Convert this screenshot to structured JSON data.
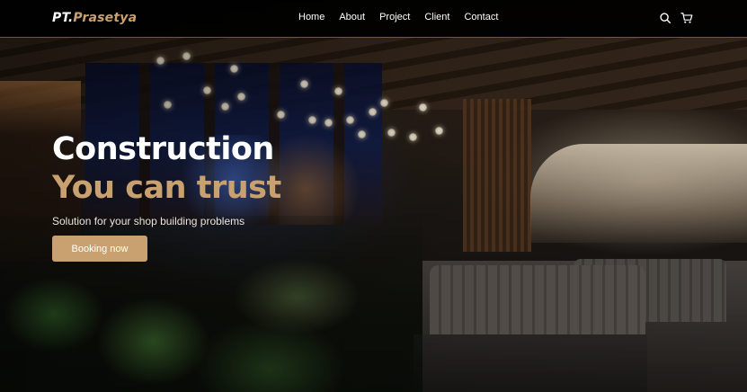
{
  "brand": {
    "name_main": "PT.",
    "name_accent": "Prasetya"
  },
  "nav": {
    "links": [
      {
        "label": "Home"
      },
      {
        "label": "About"
      },
      {
        "label": "Project"
      },
      {
        "label": "Client"
      },
      {
        "label": "Contact"
      }
    ],
    "icons": [
      "search-icon",
      "cart-icon"
    ]
  },
  "hero": {
    "title": "Construction",
    "subtitle": "You can trust",
    "tagline": "Solution for your shop building problems",
    "cta_label": "Booking now"
  },
  "colors": {
    "accent": "#c9a170",
    "navbar_bg": "#000000",
    "text": "#ffffff"
  }
}
